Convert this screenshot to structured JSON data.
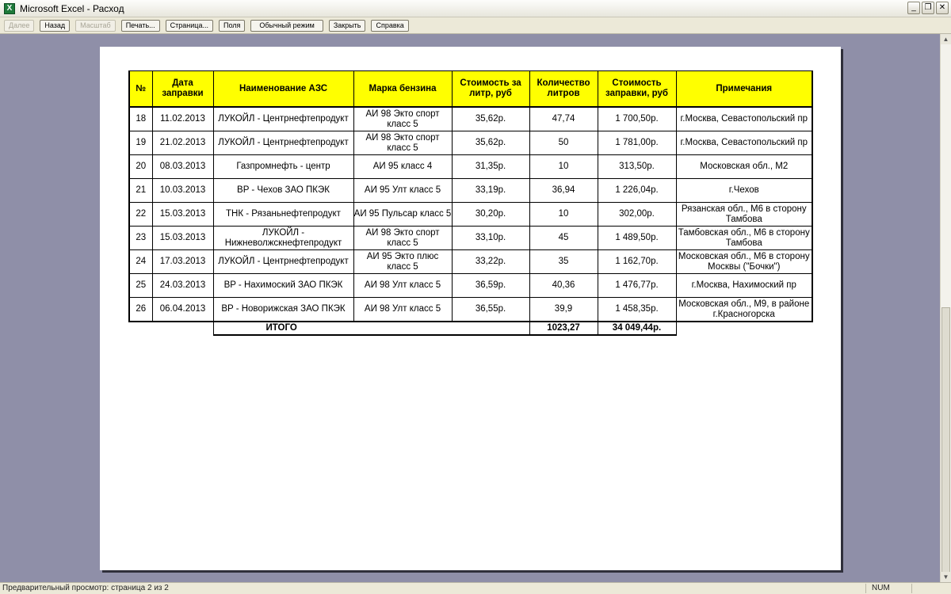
{
  "window": {
    "title": "Microsoft Excel - Расход",
    "app_icon": "X"
  },
  "window_controls": {
    "minimize": "_",
    "restore": "❐",
    "close": "✕"
  },
  "toolbar": {
    "next": "Далее",
    "back": "Назад",
    "zoom": "Масштаб",
    "print": "Печать...",
    "page_setup": "Страница...",
    "margins": "Поля",
    "normal_view": "Обычный режим",
    "close": "Закрыть",
    "help": "Справка"
  },
  "table": {
    "headers": [
      "№",
      "Дата заправки",
      "Наименование АЗС",
      "Марка бензина",
      "Стоимость за литр, руб",
      "Количество литров",
      "Стоимость заправки, руб",
      "Примечания"
    ],
    "rows": [
      [
        "18",
        "11.02.2013",
        "ЛУКОЙЛ - Центрнефтепродукт",
        "АИ 98 Экто спорт класс 5",
        "35,62р.",
        "47,74",
        "1 700,50р.",
        "г.Москва, Севастопольский пр"
      ],
      [
        "19",
        "21.02.2013",
        "ЛУКОЙЛ - Центрнефтепродукт",
        "АИ 98 Экто спорт класс 5",
        "35,62р.",
        "50",
        "1 781,00р.",
        "г.Москва, Севастопольский пр"
      ],
      [
        "20",
        "08.03.2013",
        "Газпромнефть - центр",
        "АИ 95 класс 4",
        "31,35р.",
        "10",
        "313,50р.",
        "Московская обл., М2"
      ],
      [
        "21",
        "10.03.2013",
        "BP - Чехов ЗАО ПКЭК",
        "АИ 95 Улт класс 5",
        "33,19р.",
        "36,94",
        "1 226,04р.",
        "г.Чехов"
      ],
      [
        "22",
        "15.03.2013",
        "ТНК - Рязаньнефтепродукт",
        "АИ 95 Пульсар класс 5",
        "30,20р.",
        "10",
        "302,00р.",
        "Рязанская обл., М6 в сторону Тамбова"
      ],
      [
        "23",
        "15.03.2013",
        "ЛУКОЙЛ - Нижневолжскнефтепродукт",
        "АИ 98 Экто спорт класс 5",
        "33,10р.",
        "45",
        "1 489,50р.",
        "Тамбовская обл., М6 в сторону Тамбова"
      ],
      [
        "24",
        "17.03.2013",
        "ЛУКОЙЛ - Центрнефтепродукт",
        "АИ 95 Экто плюс класс 5",
        "33,22р.",
        "35",
        "1 162,70р.",
        "Московская обл., М6 в сторону Москвы (\"Бочки\")"
      ],
      [
        "25",
        "24.03.2013",
        "BP - Нахимоский ЗАО ПКЭК",
        "АИ 98 Улт класс 5",
        "36,59р.",
        "40,36",
        "1 476,77р.",
        "г.Москва, Нахимоский пр"
      ],
      [
        "26",
        "06.04.2013",
        "BP - Новорижская ЗАО ПКЭК",
        "АИ 98 Улт класс 5",
        "36,55р.",
        "39,9",
        "1 458,35р.",
        "Московская обл., М9, в районе г.Красногорска"
      ]
    ],
    "total": {
      "label": "ИТОГО",
      "liters": "1023,27",
      "cost": "34 049,44р."
    }
  },
  "status": {
    "text": "Предварительный просмотр: страница 2 из 2",
    "num": "NUM"
  }
}
